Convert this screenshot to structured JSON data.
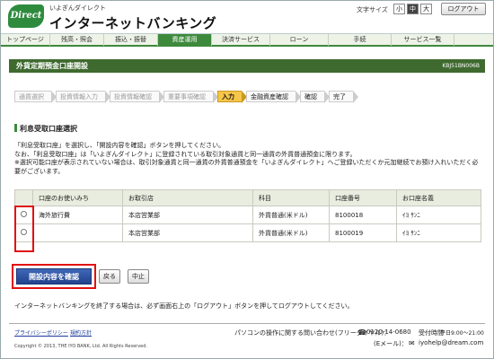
{
  "header": {
    "logo_text": "Direct",
    "brand_sub": "いよぎんダイレクト",
    "brand_main": "インターネットバンキング",
    "font_size_label": "文字サイズ",
    "font_sizes": [
      "小",
      "中",
      "大"
    ],
    "logout_label": "ログアウト"
  },
  "nav": {
    "items": [
      "トップページ",
      "残高・照会",
      "振込・振替",
      "資産運用",
      "決済サービス",
      "ローン",
      "手続",
      "サービス一覧"
    ],
    "active_index": 3
  },
  "page": {
    "title": "外貨定期預金口座開設",
    "code": "KBJ51BN006B"
  },
  "steps": [
    {
      "label": "通貨選択",
      "state": "done"
    },
    {
      "label": "投資情報入力",
      "state": "done"
    },
    {
      "label": "投資情報確認",
      "state": "done"
    },
    {
      "label": "重要事項確認",
      "state": "done"
    },
    {
      "label": "入力",
      "state": "current"
    },
    {
      "label": "金融資産確認",
      "state": "future"
    },
    {
      "label": "確認",
      "state": "future"
    },
    {
      "label": "完了",
      "state": "future"
    }
  ],
  "section": {
    "heading": "利息受取口座選択",
    "note1": "「利息受取口座」を選択し、「開設内容を確認」ボタンを押してください。",
    "note2": "なお、「利息受取口座」は「いよぎんダイレクト」に登録されている取引対象通貨と同一通貨の外貨普通預金に限ります。",
    "note3": "※選択可能口座が表示されていない場合は、取引対象通貨と同一通貨の外貨普通預金を「いよぎんダイレクト」へご登録いただくか元加継続でお預け入れいただく必要がございます。"
  },
  "table": {
    "headers": [
      "",
      "口座のお使いみち",
      "お取引店",
      "科目",
      "口座番号",
      "お口座名義"
    ],
    "rows": [
      [
        "",
        "海外旅行費",
        "本店営業部",
        "外貨普通(米ドル)",
        "8100018",
        "ｲﾖ ｻﾝﾆ"
      ],
      [
        "",
        "",
        "本店営業部",
        "外貨普通(米ドル)",
        "8100019",
        "ｲﾖ ｻﾝﾆ"
      ]
    ]
  },
  "buttons": {
    "confirm": "開設内容を確認",
    "back": "戻る",
    "cancel": "中止"
  },
  "logout_note": "インターネットバンキングを終了する場合は、必ず画面右上の「ログアウト」ボタンを押してログアウトしてください。",
  "footer": {
    "privacy": "プライバシーポリシー",
    "terms": "規約方針",
    "copyright": "Copyright © 2013, THE IYO BANK, Ltd. All Rights Reserved.",
    "contact_label": "パソコンの操作に関する問い合わせ(フリーダイヤル)：",
    "phone": "0120-14-0680",
    "hours_label": "受付時間",
    "hours": "平日9:00～21:00",
    "email_label": "(Eメール)：",
    "email": "iyohelp@dream.com"
  },
  "colors": {
    "brand_green": "#3d8a3d",
    "title_bar": "#3f6a2f",
    "current_step": "#f6c64a",
    "primary_button": "#22428e",
    "highlight": "#e01010"
  }
}
